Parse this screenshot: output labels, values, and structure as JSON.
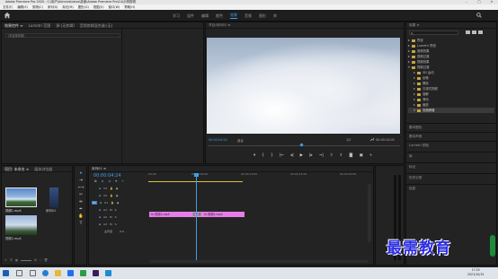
{
  "window": {
    "title": "Adobe Premiere Pro 2020 - C:\\用户\\Administrator\\桌面\\Adobe Premiere Pro\\14\\示例剪辑",
    "minimize": "–",
    "maximize": "□",
    "close": "✕"
  },
  "menu": [
    "文件(F)",
    "编辑(E)",
    "剪辑(C)",
    "序列(S)",
    "标记(M)",
    "图形(G)",
    "视图(V)",
    "窗口(W)",
    "帮助(H)"
  ],
  "workspaces": [
    {
      "label": "学习",
      "active": false
    },
    {
      "label": "组件",
      "active": false
    },
    {
      "label": "编辑",
      "active": false
    },
    {
      "label": "颜色",
      "active": false
    },
    {
      "label": "效果",
      "active": true
    },
    {
      "label": "音频",
      "active": false
    },
    {
      "label": "图形",
      "active": false
    },
    {
      "label": "库",
      "active": false
    }
  ],
  "source_panel": {
    "tabs": [
      "效果控件 ≡",
      "Lumetri 范围",
      "源:(无剪辑)",
      "音频剪辑混合器:(无)"
    ],
    "empty_message": "(未选择剪辑)"
  },
  "program_monitor": {
    "tab": "节目:序列01 ≡",
    "timecode_left": "00:00:04:24",
    "fit": "适合",
    "quality": "1/2",
    "timecode_right": "00:00:10:00"
  },
  "project_panel": {
    "tabs": [
      "项目: 未命名 ≡",
      "媒体浏览器"
    ],
    "items": [
      {
        "name": "视频1.mp4",
        "duration": "5:00"
      },
      {
        "name": "序列01",
        "duration": "10:00"
      },
      {
        "name": "视频2.mp4",
        "duration": "5:00"
      }
    ]
  },
  "timeline": {
    "tab": "序列01 ≡",
    "timecode": "00:00:04:24",
    "ruler": [
      "00:00",
      "00:00:05:00",
      "00:00:10:00",
      "00:00:15:00",
      "00:00:20:00"
    ],
    "video_tracks": [
      "V3",
      "V2",
      "V1"
    ],
    "audio_tracks": [
      "A1",
      "A2",
      "A3"
    ],
    "master": "主声道",
    "master_value": "0.0",
    "clips": [
      {
        "label": "fx 视频1.mp4",
        "track": "V1"
      },
      {
        "label": "fx 视频2.mp4",
        "track": "V1"
      }
    ],
    "transition": "交叉溶解"
  },
  "effects_panel": {
    "tab": "效果 ≡",
    "tree": [
      {
        "label": "预设",
        "level": 0
      },
      {
        "label": "Lumetri 预设",
        "level": 0
      },
      {
        "label": "音频效果",
        "level": 0
      },
      {
        "label": "音频过渡",
        "level": 0
      },
      {
        "label": "视频效果",
        "level": 0
      },
      {
        "label": "视频过渡",
        "level": 0
      },
      {
        "label": "3D 运动",
        "level": 1
      },
      {
        "label": "划像",
        "level": 1
      },
      {
        "label": "擦除",
        "level": 1
      },
      {
        "label": "沉浸式视频",
        "level": 1
      },
      {
        "label": "溶解",
        "level": 1
      },
      {
        "label": "滑动",
        "level": 1
      },
      {
        "label": "缩放",
        "level": 1
      },
      {
        "label": "页面剥落",
        "level": 1,
        "selected": true
      }
    ],
    "sections": [
      "基本图形",
      "基本声音",
      "Lumetri 颜色",
      "库",
      "标记",
      "历史记录",
      "信息"
    ]
  },
  "watermark": "最需教育",
  "taskbar": {
    "time": "17:25",
    "date": "2021/10/15"
  }
}
